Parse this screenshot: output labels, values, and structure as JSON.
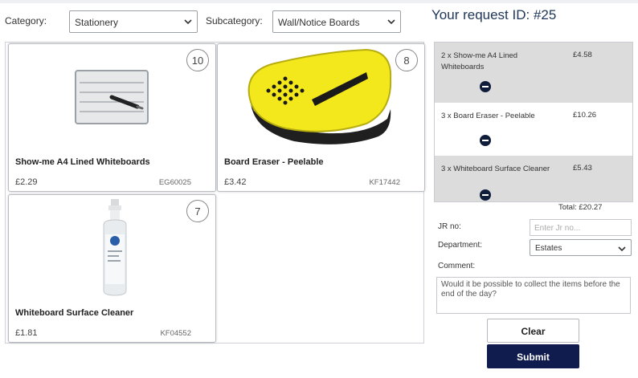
{
  "filters": {
    "category_label": "Category:",
    "category_value": "Stationery",
    "subcategory_label": "Subcategory:",
    "subcategory_value": "Wall/Notice Boards"
  },
  "request": {
    "id_text": "Your request ID:  #25"
  },
  "products": [
    {
      "name": "Show-me A4 Lined Whiteboards",
      "price": "£2.29",
      "code": "EG60025",
      "count": "10",
      "image": "whiteboard-image"
    },
    {
      "name": "Board Eraser - Peelable",
      "price": "£3.42",
      "code": "KF17442",
      "count": "8",
      "image": "board-eraser-image"
    },
    {
      "name": "Whiteboard Surface Cleaner",
      "price": "£1.81",
      "code": "KF04552",
      "count": "7",
      "image": "cleaner-spray-image"
    }
  ],
  "order": {
    "items": [
      {
        "name": "2 x Show-me A4 Lined Whiteboards",
        "price": "£4.58"
      },
      {
        "name": "3 x Board Eraser - Peelable",
        "price": "£10.26"
      },
      {
        "name": "3 x Whiteboard Surface Cleaner",
        "price": "£5.43"
      }
    ],
    "total": "Total:  £20.27"
  },
  "form": {
    "jr_label": "JR no:",
    "jr_placeholder": "Enter Jr no...",
    "department_label": "Department:",
    "department_value": "Estates",
    "comment_label": "Comment:",
    "comment_value": "Would it be possible to collect the items before the end of the day?",
    "clear_label": "Clear",
    "submit_label": "Submit"
  },
  "colors": {
    "accent_navy": "#0f1c4d",
    "title_blue": "#1d3557",
    "order_gray": "#dcdcdc"
  }
}
